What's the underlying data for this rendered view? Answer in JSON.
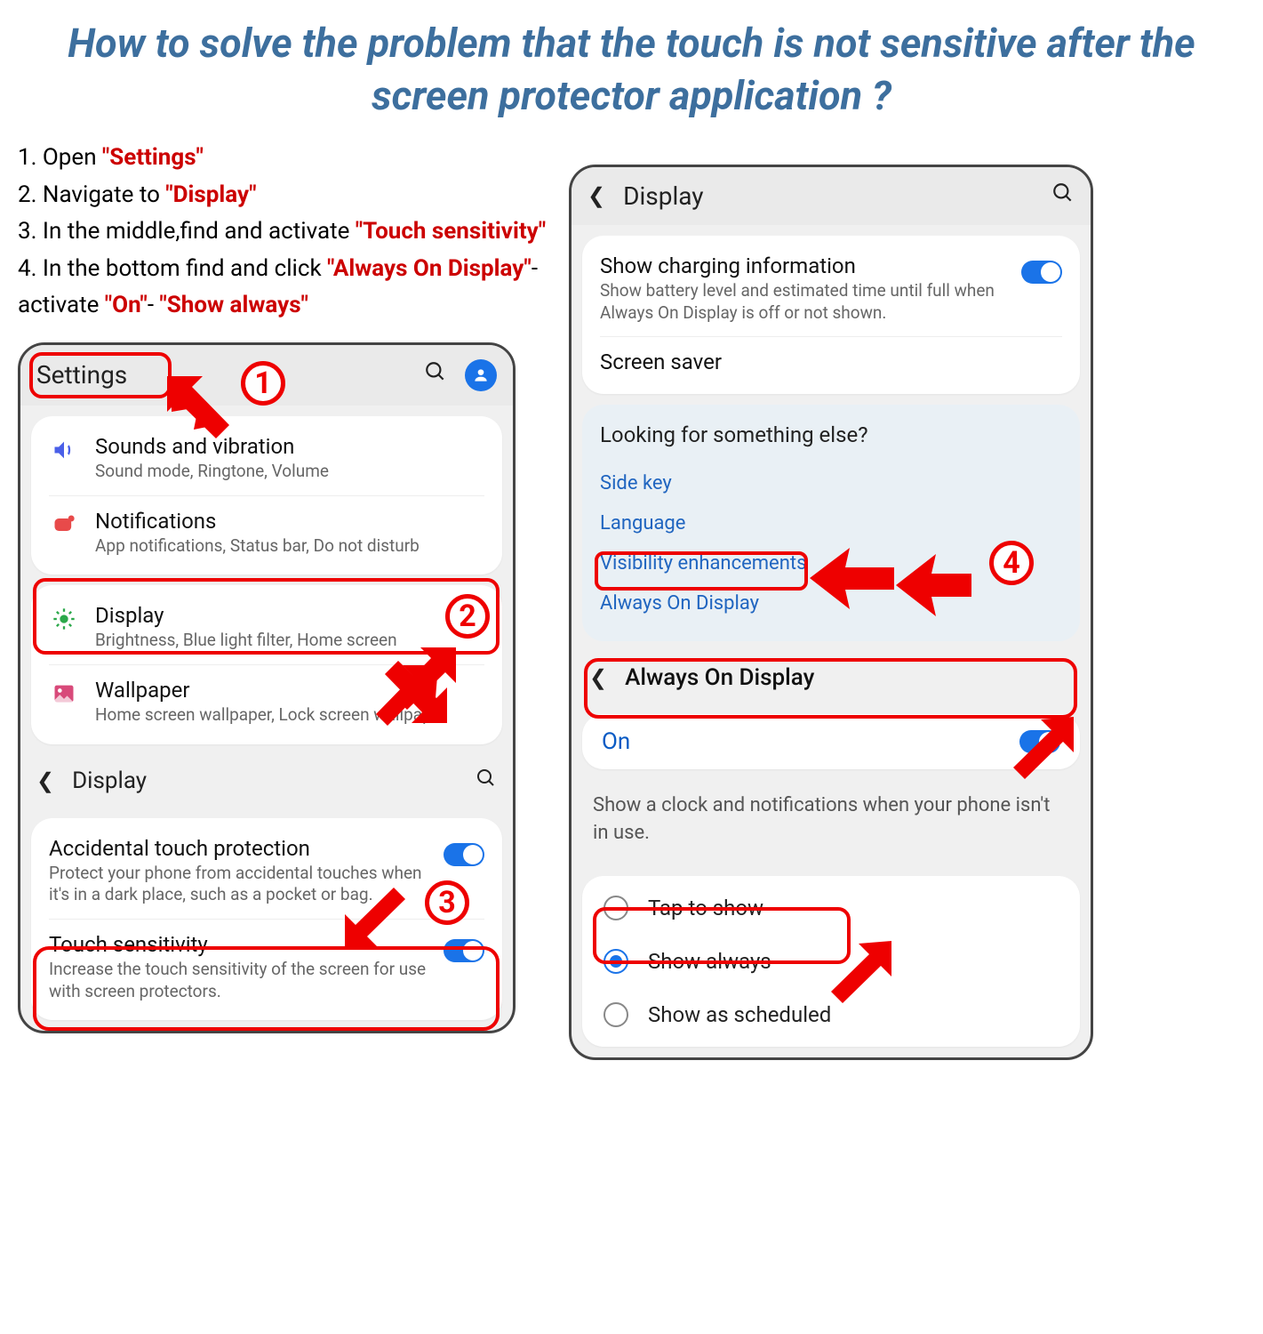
{
  "title": "How to solve the problem that the touch is not sensitive after  the screen protector application ?",
  "steps": {
    "s1_pre": "1. Open ",
    "s1_red": "\"Settings\"",
    "s2_pre": "2. Navigate to ",
    "s2_red": "\"Display\"",
    "s3_pre": "3. In the middle,find and activate ",
    "s3_red": "\"Touch sensitivity\"",
    "s4_pre": "4. In the bottom find and click ",
    "s4_red1": "\"Always On Display\"",
    "s4_mid1": "- activate ",
    "s4_red2": "\"On\"",
    "s4_mid2": "- ",
    "s4_red3": "\"Show always\""
  },
  "callouts": {
    "n1": "1",
    "n2": "2",
    "n3": "3",
    "n4": "4"
  },
  "left": {
    "header": "Settings",
    "rows": {
      "sounds": {
        "title": "Sounds and vibration",
        "sub": "Sound mode, Ringtone, Volume"
      },
      "notifications": {
        "title": "Notifications",
        "sub": "App notifications, Status bar, Do not disturb"
      },
      "display": {
        "title": "Display",
        "sub": "Brightness, Blue light filter, Home screen"
      },
      "wallpaper": {
        "title": "Wallpaper",
        "sub": "Home screen wallpaper, Lock screen wallpaper"
      }
    },
    "display_header": "Display",
    "atp": {
      "title": "Accidental touch protection",
      "sub": "Protect your phone from accidental touches when it's in a dark place, such as a pocket or bag."
    },
    "touch": {
      "title": "Touch sensitivity",
      "sub": "Increase the touch sensitivity of the screen for use with screen protectors."
    }
  },
  "right": {
    "header": "Display",
    "charging": {
      "title": "Show charging information",
      "sub": "Show battery level and estimated time until full when Always On Display is off or not shown."
    },
    "screensaver": "Screen saver",
    "looking": {
      "title": "Looking for something else?",
      "links": {
        "sidekey": "Side key",
        "language": "Language",
        "visibility": "Visibility enhancements",
        "aod": "Always On Display"
      }
    },
    "aod_header": "Always On Display",
    "on_label": "On",
    "desc": "Show a clock and notifications when your phone isn't in use.",
    "options": {
      "tap": "Tap to show",
      "always": "Show always",
      "scheduled": "Show as scheduled"
    }
  }
}
